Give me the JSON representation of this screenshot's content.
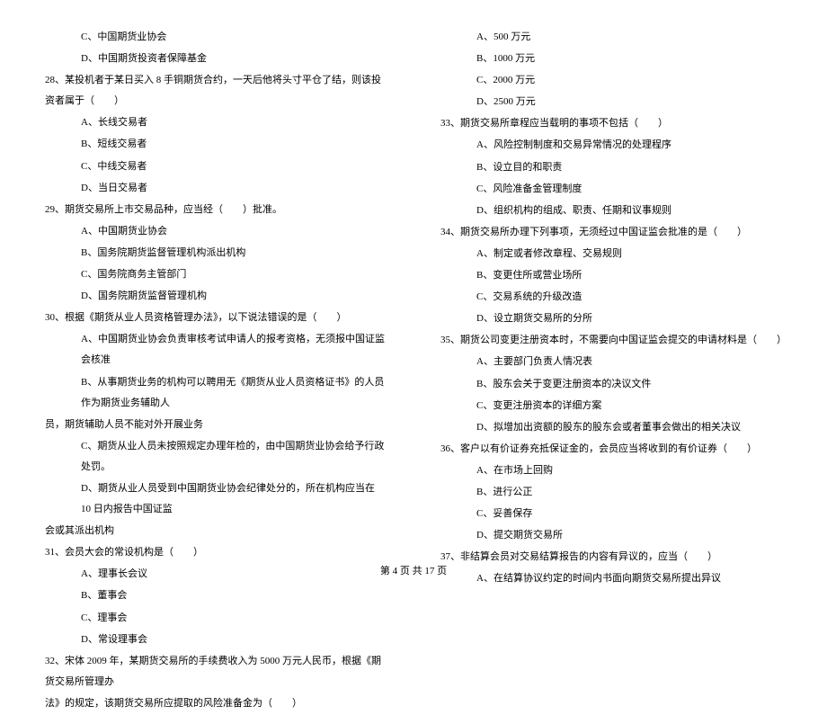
{
  "left_column": [
    {
      "type": "option",
      "text": "C、中国期货业协会"
    },
    {
      "type": "option",
      "text": "D、中国期货投资者保障基金"
    },
    {
      "type": "question",
      "text": "28、某投机者于某日买入 8 手铜期货合约，一天后他将头寸平仓了结，则该投资者属于（　　）"
    },
    {
      "type": "option",
      "text": "A、长线交易者"
    },
    {
      "type": "option",
      "text": "B、短线交易者"
    },
    {
      "type": "option",
      "text": "C、中线交易者"
    },
    {
      "type": "option",
      "text": "D、当日交易者"
    },
    {
      "type": "question",
      "text": "29、期货交易所上市交易品种，应当经（　　）批准。"
    },
    {
      "type": "option",
      "text": "A、中国期货业协会"
    },
    {
      "type": "option",
      "text": "B、国务院期货监督管理机构派出机构"
    },
    {
      "type": "option",
      "text": "C、国务院商务主管部门"
    },
    {
      "type": "option",
      "text": "D、国务院期货监督管理机构"
    },
    {
      "type": "question",
      "text": "30、根据《期货从业人员资格管理办法》，以下说法错误的是（　　）"
    },
    {
      "type": "option",
      "text": "A、中国期货业协会负责审核考试申请人的报考资格，无须报中国证监会核准"
    },
    {
      "type": "option",
      "text": "B、从事期货业务的机构可以聘用无《期货从业人员资格证书》的人员作为期货业务辅助人"
    },
    {
      "type": "continuation",
      "text": "员，期货辅助人员不能对外开展业务"
    },
    {
      "type": "option",
      "text": "C、期货从业人员未按照规定办理年检的，由中国期货业协会给予行政处罚。"
    },
    {
      "type": "option",
      "text": "D、期货从业人员受到中国期货业协会纪律处分的，所在机构应当在 10 日内报告中国证监"
    },
    {
      "type": "continuation",
      "text": "会或其派出机构"
    },
    {
      "type": "question",
      "text": "31、会员大会的常设机构是（　　）"
    },
    {
      "type": "option",
      "text": "A、理事长会议"
    },
    {
      "type": "option",
      "text": "B、董事会"
    },
    {
      "type": "option",
      "text": "C、理事会"
    },
    {
      "type": "option",
      "text": "D、常设理事会"
    },
    {
      "type": "question",
      "text": "32、宋体 2009 年，某期货交易所的手续费收入为 5000 万元人民币，根据《期货交易所管理办"
    },
    {
      "type": "continuation",
      "text": "法》的规定，该期货交易所应提取的风险准备金为（　　）"
    }
  ],
  "right_column": [
    {
      "type": "option",
      "text": "A、500 万元"
    },
    {
      "type": "option",
      "text": "B、1000 万元"
    },
    {
      "type": "option",
      "text": "C、2000 万元"
    },
    {
      "type": "option",
      "text": "D、2500 万元"
    },
    {
      "type": "question",
      "text": "33、期货交易所章程应当载明的事项不包括（　　）"
    },
    {
      "type": "option",
      "text": "A、风险控制制度和交易异常情况的处理程序"
    },
    {
      "type": "option",
      "text": "B、设立目的和职责"
    },
    {
      "type": "option",
      "text": "C、风险准备金管理制度"
    },
    {
      "type": "option",
      "text": "D、组织机构的组成、职责、任期和议事规则"
    },
    {
      "type": "question",
      "text": "34、期货交易所办理下列事项，无须经过中国证监会批准的是（　　）"
    },
    {
      "type": "option",
      "text": "A、制定或者修改章程、交易规则"
    },
    {
      "type": "option",
      "text": "B、变更住所或营业场所"
    },
    {
      "type": "option",
      "text": "C、交易系统的升级改造"
    },
    {
      "type": "option",
      "text": "D、设立期货交易所的分所"
    },
    {
      "type": "question",
      "text": "35、期货公司变更注册资本时，不需要向中国证监会提交的申请材料是（　　）"
    },
    {
      "type": "option",
      "text": "A、主要部门负责人情况表"
    },
    {
      "type": "option",
      "text": "B、股东会关于变更注册资本的决议文件"
    },
    {
      "type": "option",
      "text": "C、变更注册资本的详细方案"
    },
    {
      "type": "option",
      "text": "D、拟增加出资额的股东的股东会或者董事会做出的相关决议"
    },
    {
      "type": "question",
      "text": "36、客户以有价证券充抵保证金的，会员应当将收到的有价证券（　　）"
    },
    {
      "type": "option",
      "text": "A、在市场上回购"
    },
    {
      "type": "option",
      "text": "B、进行公正"
    },
    {
      "type": "option",
      "text": "C、妥善保存"
    },
    {
      "type": "option",
      "text": "D、提交期货交易所"
    },
    {
      "type": "question",
      "text": "37、非结算会员对交易结算报告的内容有异议的，应当（　　）"
    },
    {
      "type": "option",
      "text": "A、在结算协议约定的时间内书面向期货交易所提出异议"
    }
  ],
  "footer": "第 4 页 共 17 页"
}
